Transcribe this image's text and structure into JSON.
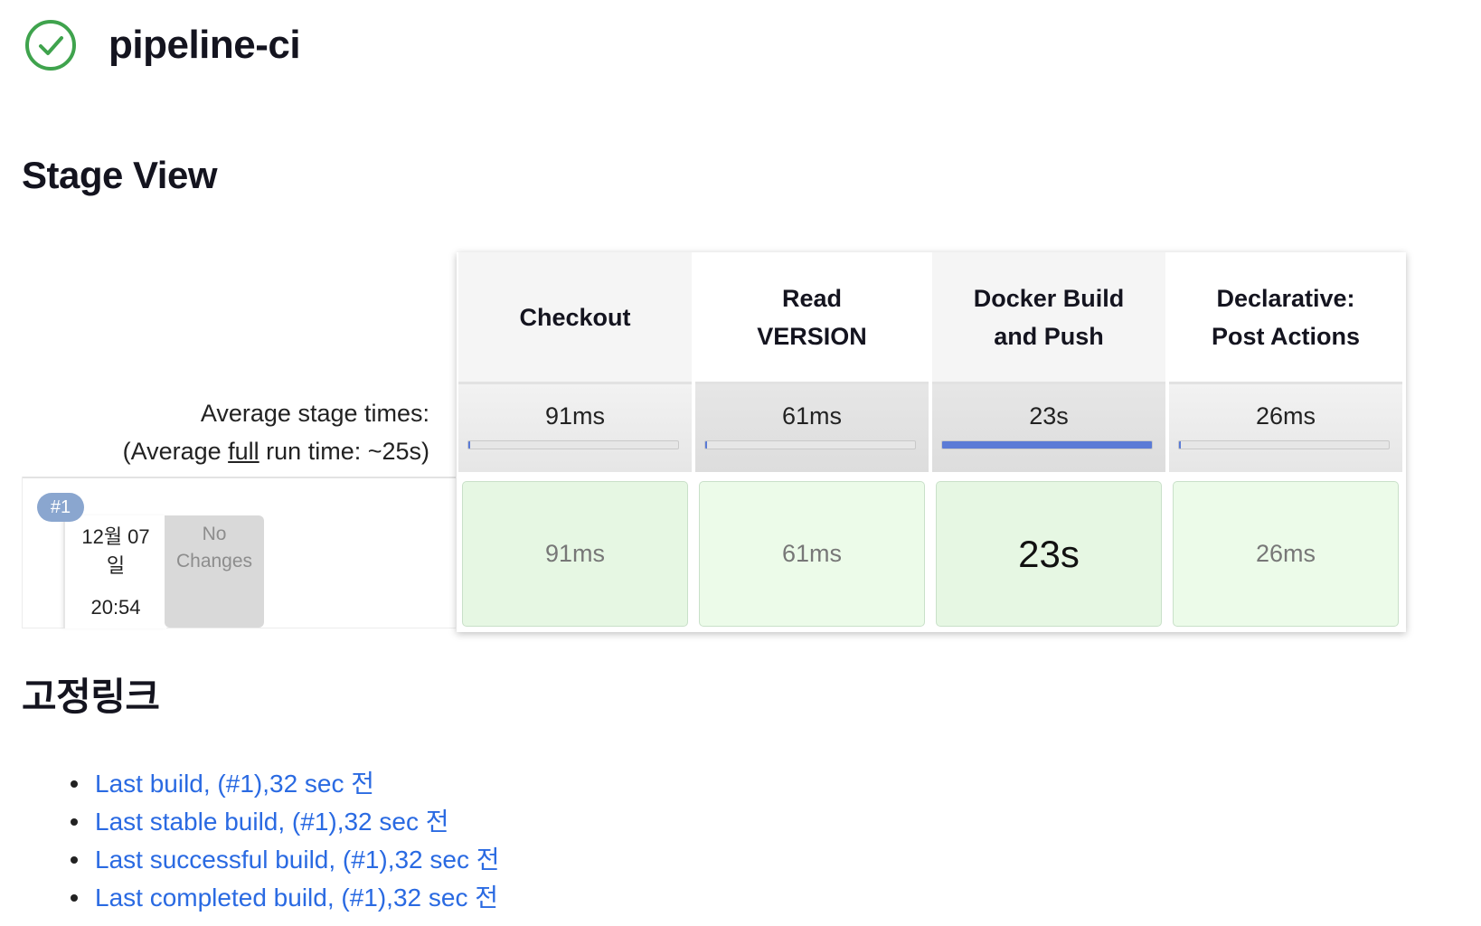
{
  "job": {
    "title": "pipeline-ci",
    "status_icon": "check-circle-icon",
    "status_color": "#3fa34d"
  },
  "stage_view": {
    "title": "Stage View",
    "average_label": "Average stage times:",
    "average_full_prefix": "(Average ",
    "average_full_link": "full",
    "average_full_suffix": " run time: ~25s)",
    "stages": [
      {
        "name_line1": "Checkout",
        "name_line2": "",
        "avg_time": "91ms",
        "avg_fraction": 0.004,
        "cell_time": "91ms"
      },
      {
        "name_line1": "Read",
        "name_line2": "VERSION",
        "avg_time": "61ms",
        "avg_fraction": 0.003,
        "cell_time": "61ms"
      },
      {
        "name_line1": "Docker Build",
        "name_line2": "and Push",
        "avg_time": "23s",
        "avg_fraction": 1.0,
        "cell_time": "23s"
      },
      {
        "name_line1": "Declarative:",
        "name_line2": "Post Actions",
        "avg_time": "26ms",
        "avg_fraction": 0.001,
        "cell_time": "26ms"
      }
    ],
    "builds": [
      {
        "number": "#1",
        "date_line1": "12월 07",
        "date_line2": "일",
        "time": "20:54",
        "changes_line1": "No",
        "changes_line2": "Changes"
      }
    ],
    "bar_color": "#5b7bd6",
    "success_color": "#e6f7e3"
  },
  "permalinks": {
    "title": "고정링크",
    "items": [
      {
        "label": "Last build, (#1),32 sec 전"
      },
      {
        "label": "Last stable build, (#1),32 sec 전"
      },
      {
        "label": "Last successful build, (#1),32 sec 전"
      },
      {
        "label": "Last completed build, (#1),32 sec 전"
      }
    ],
    "link_color": "#2a6ae2"
  }
}
